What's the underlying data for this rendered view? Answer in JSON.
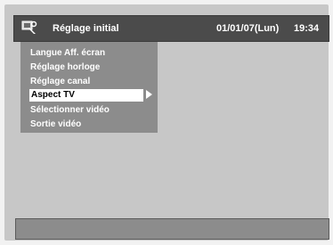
{
  "header": {
    "icon": "setup-icon",
    "title": "Réglage initial",
    "date": "01/01/07(Lun)",
    "time": "19:34"
  },
  "menu": {
    "items": [
      {
        "label": "Langue Aff. écran",
        "selected": false
      },
      {
        "label": "Réglage horloge",
        "selected": false
      },
      {
        "label": "Réglage canal",
        "selected": false
      },
      {
        "label": "Aspect TV",
        "selected": true
      },
      {
        "label": "Sélectionner vidéo",
        "selected": false
      },
      {
        "label": "Sortie vidéo",
        "selected": false
      }
    ]
  },
  "colors": {
    "header_bg": "#4b4b4b",
    "menu_bg": "#8c8c8c",
    "screen_bg": "#c7c7c7",
    "selected_bg": "#ffffff"
  }
}
